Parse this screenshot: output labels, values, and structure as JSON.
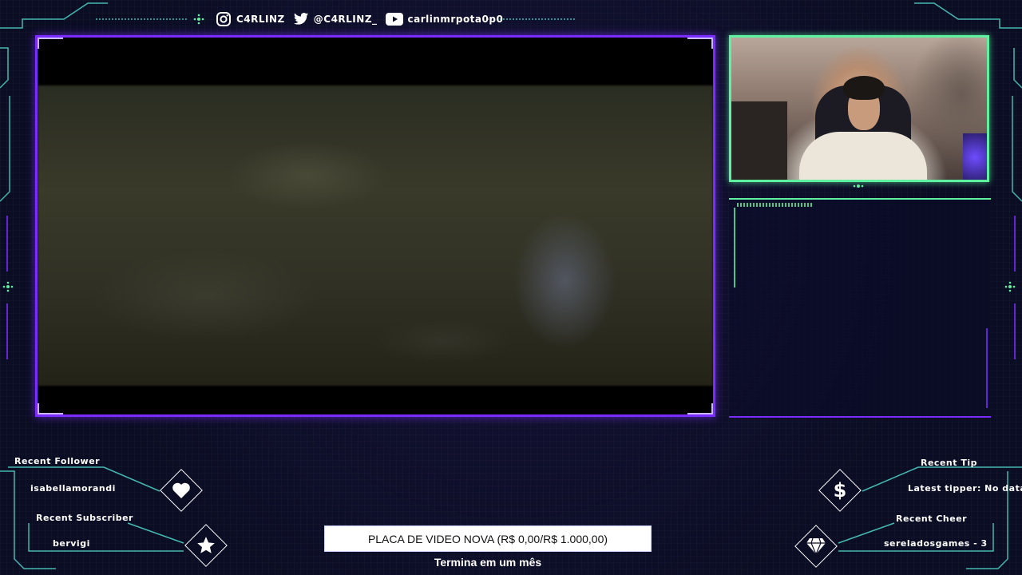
{
  "colors": {
    "accent_purple": "#7a2cff",
    "accent_green": "#5ef2a0",
    "frame_teal": "#4fd6c8",
    "background": "#0b0d24"
  },
  "social": {
    "instagram": {
      "icon": "instagram-icon",
      "handle": "C4RLINZ"
    },
    "twitter": {
      "icon": "twitter-icon",
      "handle": "@C4RLINZ_"
    },
    "youtube": {
      "icon": "youtube-icon",
      "handle": "carlinmrpota0p0"
    }
  },
  "alerts": {
    "recent_follower": {
      "label": "Recent Follower",
      "value": "isabellamorandi",
      "icon": "heart-icon"
    },
    "recent_subscriber": {
      "label": "Recent Subscriber",
      "value": "bervigi",
      "icon": "star-icon"
    },
    "recent_tip": {
      "label": "Recent Tip",
      "value": "Latest tipper: No data",
      "icon": "dollar-icon"
    },
    "recent_cheer": {
      "label": "Recent Cheer",
      "value": "sereladosgames - 3",
      "icon": "diamond-gem-icon"
    }
  },
  "goal": {
    "text": "PLACA DE VIDEO NOVA (R$ 0,00/R$ 1.000,00)",
    "progress_percent": 0,
    "subtitle": "Termina em um mês"
  }
}
